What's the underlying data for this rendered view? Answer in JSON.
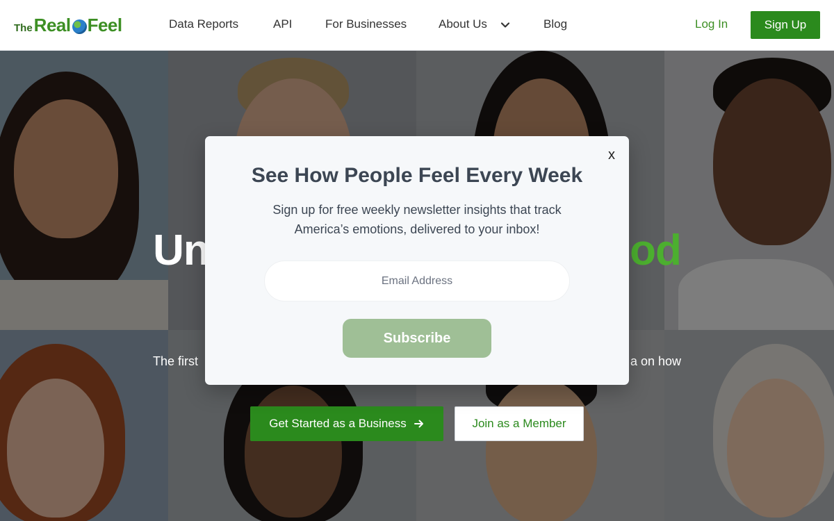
{
  "logo": {
    "the": "The",
    "real": "Real",
    "feel": "Feel"
  },
  "nav": {
    "items": [
      {
        "label": "Data Reports"
      },
      {
        "label": "API"
      },
      {
        "label": "For Businesses"
      },
      {
        "label": "About Us"
      },
      {
        "label": "Blog"
      }
    ],
    "login": "Log In",
    "signup": "Sign Up"
  },
  "hero": {
    "title_start": "Unc",
    "title_end": "ood",
    "subtitle_start": "The first",
    "subtitle_end": "a on how",
    "cta_business": "Get Started as a Business",
    "cta_member": "Join as a Member"
  },
  "modal": {
    "close": "x",
    "title": "See How People Feel Every Week",
    "text": "Sign up for free weekly newsletter insights that track America’s emotions, delivered to your inbox!",
    "email_placeholder": "Email Address",
    "subscribe": "Subscribe"
  },
  "colors": {
    "brand_green": "#2b8a1d",
    "accent_green": "#4caf2f",
    "subscribe_disabled": "#9fbf96",
    "modal_bg": "#f6f8fa"
  },
  "icons": [
    "globe-icon",
    "chevron-down-icon",
    "arrow-right-icon"
  ]
}
